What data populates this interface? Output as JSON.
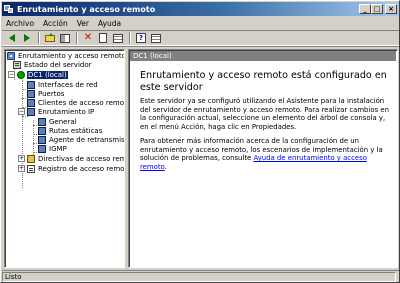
{
  "window": {
    "title": "Enrutamiento y acceso remoto",
    "minimize": "_",
    "maximize": "□",
    "close": "×"
  },
  "menu": {
    "items": [
      {
        "label": "Archivo"
      },
      {
        "label": "Acción"
      },
      {
        "label": "Ver"
      },
      {
        "label": "Ayuda"
      }
    ]
  },
  "toolbar": {
    "buttons": [
      "back-icon",
      "forward-icon",
      "up-folder-icon",
      "show-tree-icon",
      "delete-icon",
      "properties-icon",
      "refresh-icon",
      "help-icon",
      "list-icon"
    ]
  },
  "tree": {
    "root": "Enrutamiento y acceso remoto",
    "server_status": "Estado del servidor",
    "server": "DC1 (local)",
    "interfaces": "Interfaces de red",
    "ports": "Puertos",
    "clients": "Clientes de acceso remoto",
    "ip_routing": "Enrutamiento IP",
    "general": "General",
    "static_routes": "Rutas estáticas",
    "dhcp_agent": "Agente de retransmisi",
    "igmp": "IGMP",
    "policies": "Directivas de acceso remot",
    "logging": "Registro de acceso remoto"
  },
  "content": {
    "header": "DC1 (local)",
    "title": "Enrutamiento y acceso remoto está configurado en este servidor",
    "para1": "Este servidor ya se configuró utilizando el Asistente para la instalación del servidor de enrutamiento y acceso remoto. Para realizar cambios en la configuración actual, seleccione un elemento del árbol de consola y, en el menú Acción, haga clic en Propiedades.",
    "para2_prefix": "Para obtener más información acerca de la configuración de un enrutamiento y acceso remoto, los escenarios de implementación y la solución de problemas, consulte ",
    "help_link": "Ayuda de enrutamiento y acceso remoto",
    "para2_suffix": "."
  },
  "status": {
    "text": "Listo"
  }
}
